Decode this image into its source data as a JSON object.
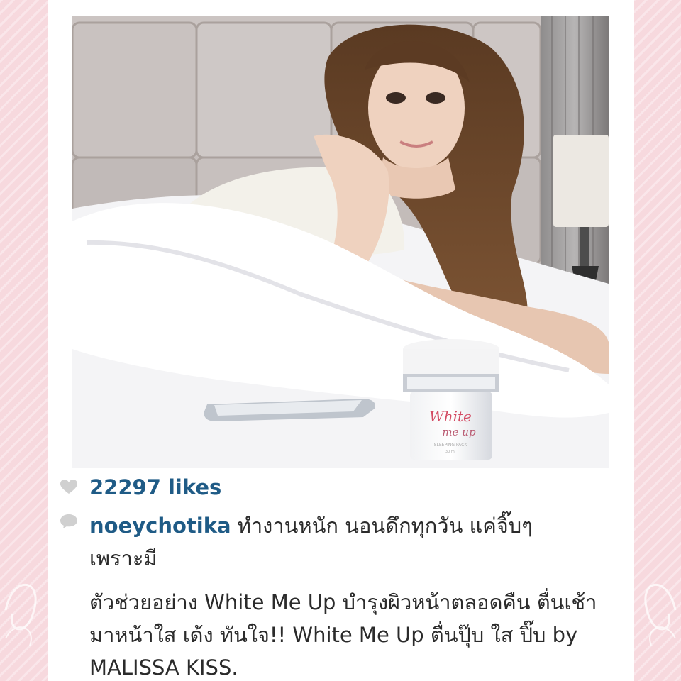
{
  "post": {
    "likes": "22297 likes",
    "username": "noeychotika",
    "caption_line1": "ทำงานหนัก นอนดึกทุกวัน แค่จิ๊บๆ",
    "caption_line2": "เพราะมี",
    "caption_para2": "ตัวช่วยอย่าง White Me Up บำรุงผิวหน้าตลอดคืน ตื่นเช้ามาหน้าใส เด้ง ทันใจ!! White Me Up ตื่นปุ๊บ ใส ปิ๊บ by MALISSA KISS.",
    "product_label": "White me up",
    "product_sublabel": "SLEEPING PACK",
    "product_size": "30 ml"
  },
  "icons": {
    "like": "heart-icon",
    "comment": "comment-icon"
  },
  "colors": {
    "background": "#f8dfe3",
    "username": "#1f5b86",
    "text": "#2b2b2b",
    "icon": "#d0d0d0"
  }
}
